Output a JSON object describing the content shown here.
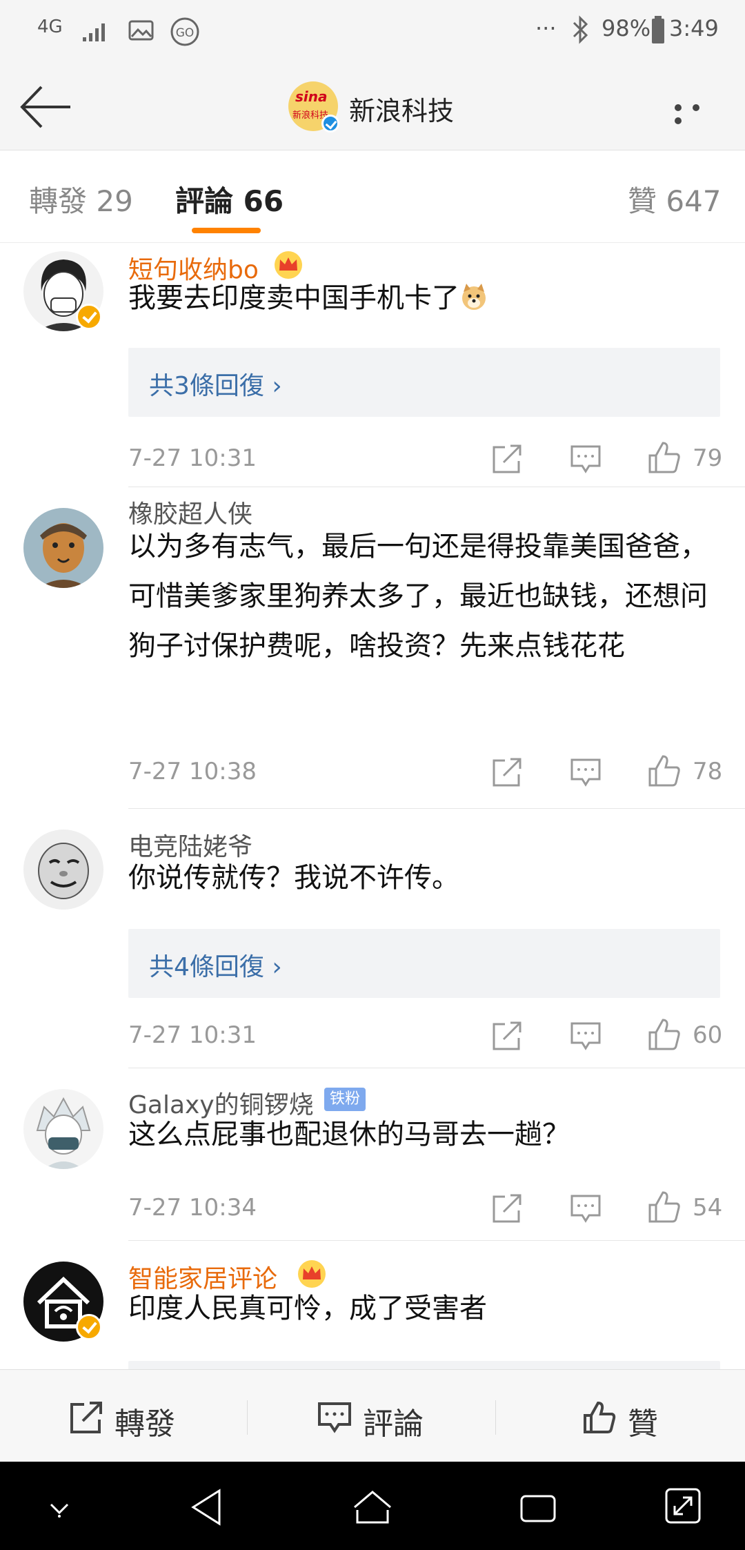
{
  "status_bar": {
    "network": "4G",
    "time": "3:49",
    "battery": "98%",
    "more": "···"
  },
  "header": {
    "account_name": "新浪科技",
    "logo_text_top": "sina",
    "logo_text_bottom": "新浪科技"
  },
  "tabs": [
    {
      "label": "轉發 29"
    },
    {
      "label": "評論 66"
    },
    {
      "label": "贊 647"
    }
  ],
  "accent_color": "#ff8200",
  "comments": [
    {
      "username": "短句收纳bo",
      "vip": true,
      "content": "我要去印度卖中国手机卡了",
      "replies_label": "共3條回復 ›",
      "time": "7-27 10:31",
      "likes": "79"
    },
    {
      "username": "橡胶超人侠",
      "vip": false,
      "content": "以为多有志气，最后一句还是得投靠美国爸爸，可惜美爹家里狗养太多了，最近也缺钱，还想问狗子讨保护费呢，啥投资？先来点钱花花",
      "time": "7-27 10:38",
      "likes": "78"
    },
    {
      "username": "电竞陆姥爷",
      "vip": false,
      "content": "你说传就传？我说不许传。",
      "replies_label": "共4條回復 ›",
      "time": "7-27 10:31",
      "likes": "60"
    },
    {
      "username": "Galaxy的铜锣烧",
      "vip": false,
      "badge": "铁粉",
      "content": "这么点屁事也配退休的马哥去一趟？",
      "time": "7-27 10:34",
      "likes": "54"
    },
    {
      "username": "智能家居评论",
      "vip": true,
      "content": "印度人民真可怜，成了受害者"
    }
  ],
  "bottom_bar": {
    "repost": "轉發",
    "comment": "評論",
    "like": "贊"
  }
}
